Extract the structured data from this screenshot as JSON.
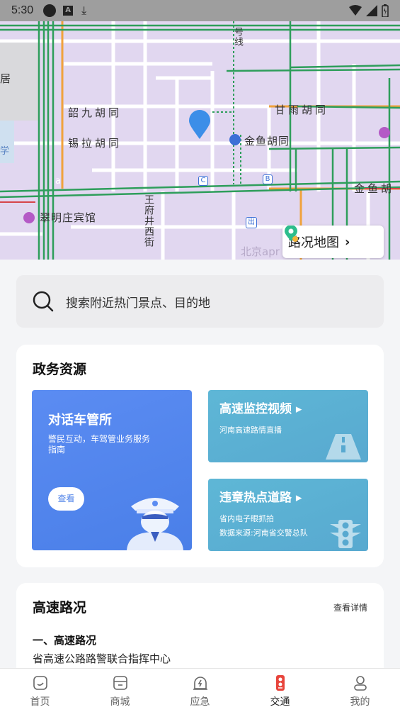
{
  "status_bar": {
    "time": "5:30"
  },
  "map": {
    "labels": {
      "shaojiu": "韶九胡同",
      "xila": "锡拉胡同",
      "ganyu": "甘雨胡同",
      "jinyu": "金鱼胡同",
      "jinyu_right": "金鱼胡",
      "hotel": "翠明庄宾馆",
      "wangfujing": "王府井西街",
      "hao_xian": "号线",
      "ju": "居",
      "xue": "学",
      "watermark": "北京apr",
      "metro_b": "B",
      "metro_c": "C",
      "exit": "出",
      "cut_left": "a"
    },
    "traffic_button": "路况地图"
  },
  "search": {
    "placeholder": "搜索附近热门景点、目的地"
  },
  "gov_section": {
    "title": "政务资源",
    "big_tile": {
      "title": "对话车管所",
      "subtitle": "警民互动，车驾管业务服务指南",
      "button": "查看"
    },
    "tile1": {
      "title": "高速监控视频",
      "subtitle": "河南高速路情直播"
    },
    "tile2": {
      "title": "违章热点道路",
      "subtitle1": "省内电子眼抓拍",
      "subtitle2": "数据来源:河南省交警总队"
    }
  },
  "highway_section": {
    "title": "高速路况",
    "detail_link": "查看详情",
    "heading": "一、高速路况",
    "line1": "省高速公路路警联合指挥中心"
  },
  "tabs": [
    {
      "label": "首页",
      "icon": "home-icon"
    },
    {
      "label": "商城",
      "icon": "shop-icon"
    },
    {
      "label": "应急",
      "icon": "emergency-icon"
    },
    {
      "label": "交通",
      "icon": "traffic-light-icon"
    },
    {
      "label": "我的",
      "icon": "user-icon"
    }
  ],
  "colors": {
    "accent": "#e8453c",
    "map_bg": "#e1d7f0",
    "road_green": "#2e9e5b",
    "blue_tile": "#4a7fe8",
    "teal_tile": "#58a9d0",
    "marker": "#3c8ee8"
  }
}
